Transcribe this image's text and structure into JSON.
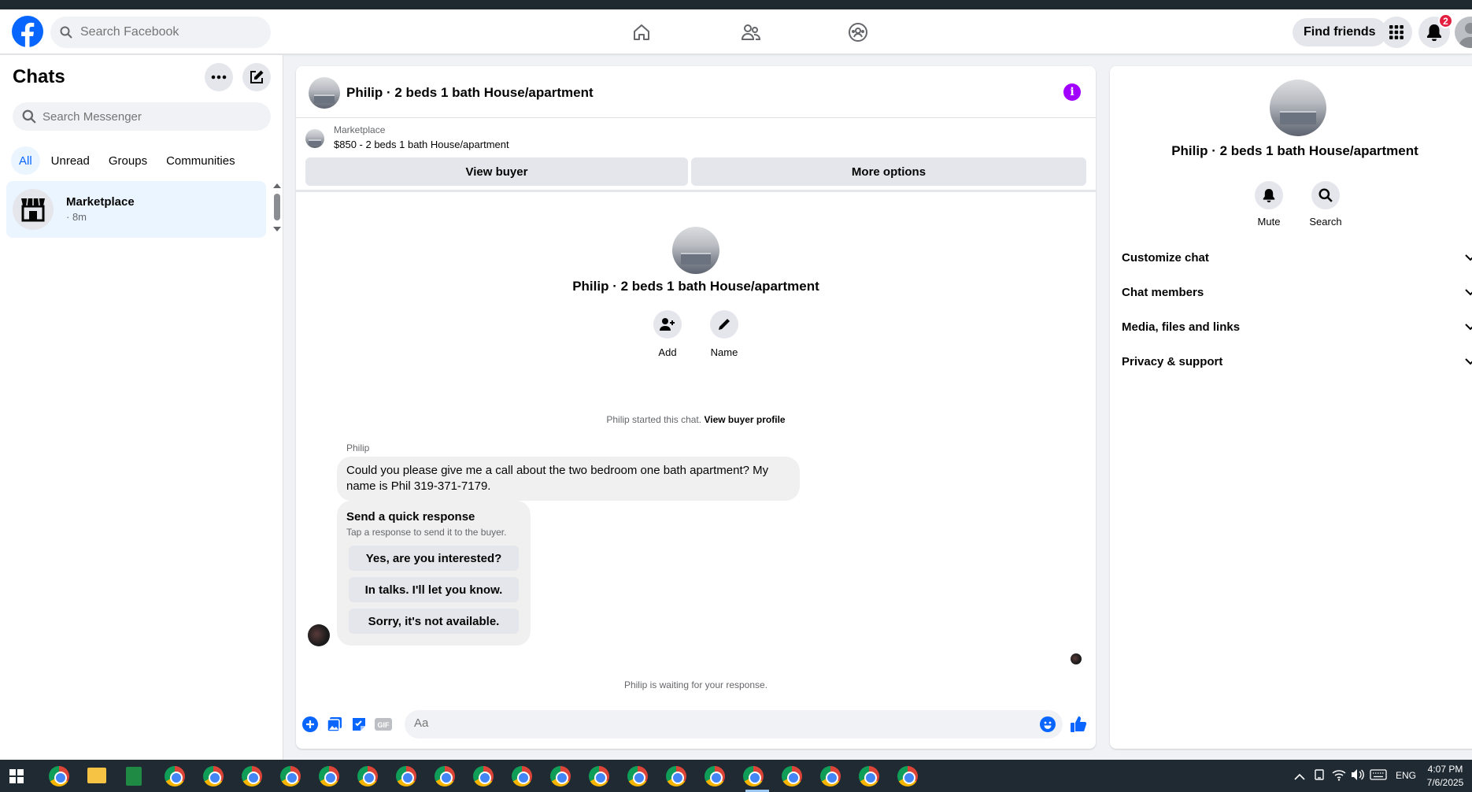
{
  "header": {
    "search_placeholder": "Search Facebook",
    "find_friends_label": "Find friends",
    "notification_count": "2"
  },
  "sidebar": {
    "title": "Chats",
    "search_placeholder": "Search Messenger",
    "filters": [
      "All",
      "Unread",
      "Groups",
      "Communities"
    ],
    "active_filter": "All",
    "chats": [
      {
        "name": "Marketplace",
        "time": "· 8m"
      }
    ]
  },
  "conversation": {
    "title": "Philip · 2 beds 1 bath House/apartment",
    "marketplace": {
      "label": "Marketplace",
      "item": "$850 - 2 beds 1 bath House/apartment",
      "view_buyer_label": "View buyer",
      "more_options_label": "More options"
    },
    "intro": {
      "name": "Philip · 2 beds 1 bath House/apartment",
      "add_label": "Add",
      "name_label": "Name"
    },
    "started_text": "Philip started this chat.",
    "view_profile_link": "View buyer profile",
    "sender": "Philip",
    "message": "Could you please give me a call about the two bedroom one bath apartment? My name is Phil 319-371-7179.",
    "quick_response": {
      "title": "Send a quick response",
      "subtitle": "Tap a response to send it to the buyer.",
      "options": [
        "Yes, are you interested?",
        "In talks. I'll let you know.",
        "Sorry, it's not available."
      ]
    },
    "waiting_text": "Philip is waiting for your response.",
    "composer_placeholder": "Aa"
  },
  "info_panel": {
    "name": "Philip · 2 beds 1 bath House/apartment",
    "mute_label": "Mute",
    "search_label": "Search",
    "sections": [
      "Customize chat",
      "Chat members",
      "Media, files and links",
      "Privacy & support"
    ]
  },
  "taskbar": {
    "language": "ENG",
    "time": "4:07 PM",
    "date": "7/6/2025"
  },
  "colors": {
    "brand": "#0866ff",
    "accent_purple": "#a100ff",
    "badge_red": "#e41e3f"
  }
}
